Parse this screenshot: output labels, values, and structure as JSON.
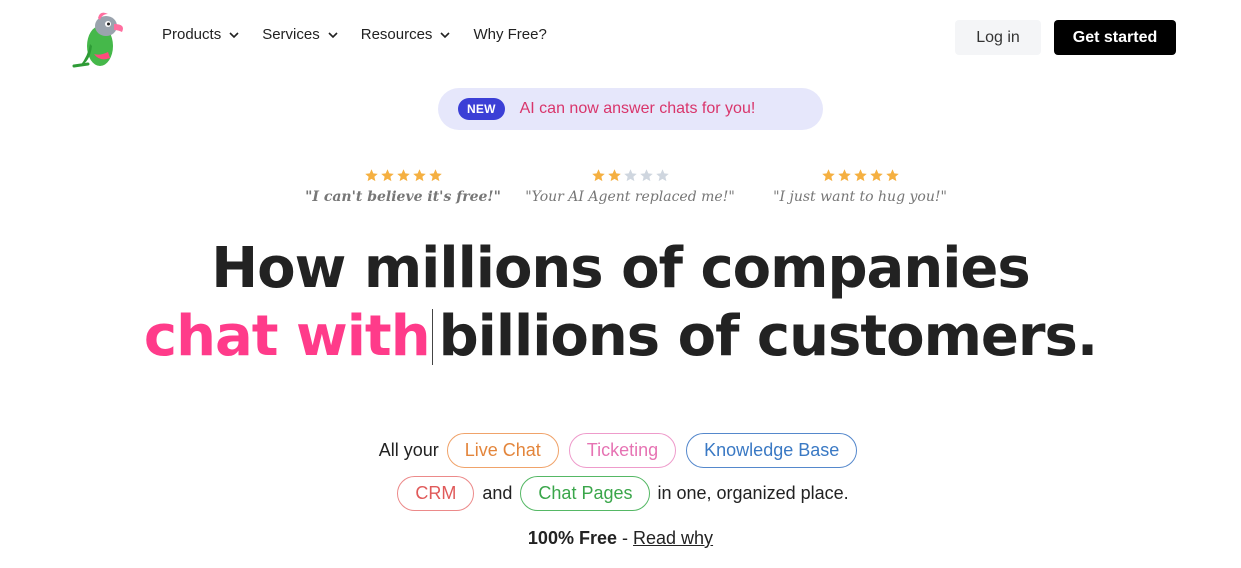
{
  "nav": {
    "items": [
      {
        "label": "Products",
        "has_dropdown": true
      },
      {
        "label": "Services",
        "has_dropdown": true
      },
      {
        "label": "Resources",
        "has_dropdown": true
      },
      {
        "label": "Why Free?",
        "has_dropdown": false
      }
    ],
    "login_label": "Log in",
    "get_started_label": "Get started",
    "logo_icon": "parrot-logo-icon"
  },
  "announcement": {
    "badge": "NEW",
    "message": "AI can now answer chats for you!"
  },
  "reviews": [
    {
      "quote": "\"I can't believe it's free!\"",
      "rating": 5
    },
    {
      "quote": "\"Your AI Agent replaced me!\"",
      "rating": 2
    },
    {
      "quote": "\"I just want to hug you!\"",
      "rating": 5
    }
  ],
  "headline": {
    "line1": "How millions of companies",
    "line2_accent": "chat with",
    "line2_rest": "billions of customers."
  },
  "products": {
    "prefix": "All your",
    "live_chat": "Live Chat",
    "ticketing": "Ticketing",
    "knowledge_base": "Knowledge Base",
    "crm": "CRM",
    "and": "and",
    "chat_pages": "Chat Pages",
    "suffix": "in one, organized place."
  },
  "free": {
    "bold": "100% Free",
    "sep": "-",
    "link": "Read why"
  },
  "colors": {
    "accent_pink": "#ff3b8a",
    "star_gold": "#f5b041",
    "star_empty": "#cfd6df",
    "pill_bg": "#e6e7fb"
  }
}
